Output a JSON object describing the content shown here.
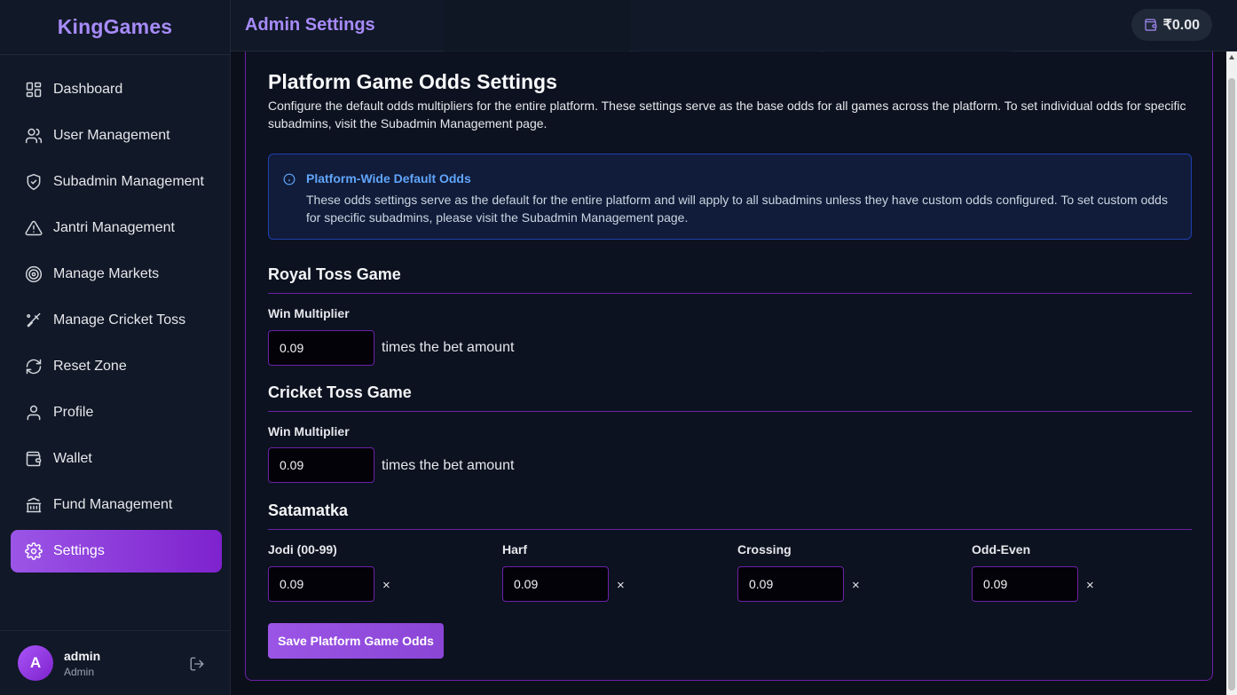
{
  "brand": "KingGames",
  "sidebar": {
    "items": [
      {
        "label": "Dashboard",
        "icon": "dashboard-grid-icon"
      },
      {
        "label": "User Management",
        "icon": "users-icon"
      },
      {
        "label": "Subadmin Management",
        "icon": "shield-icon"
      },
      {
        "label": "Jantri Management",
        "icon": "warning-triangle-icon"
      },
      {
        "label": "Manage Markets",
        "icon": "target-icon"
      },
      {
        "label": "Manage Cricket Toss",
        "icon": "cricket-bat-icon"
      },
      {
        "label": "Reset Zone",
        "icon": "refresh-icon"
      },
      {
        "label": "Profile",
        "icon": "user-icon"
      },
      {
        "label": "Wallet",
        "icon": "wallet-icon"
      },
      {
        "label": "Fund Management",
        "icon": "bank-icon"
      },
      {
        "label": "Settings",
        "icon": "gear-icon",
        "active": true
      }
    ]
  },
  "user": {
    "initial": "A",
    "name": "admin",
    "role": "Admin"
  },
  "header": {
    "title": "Admin Settings",
    "balance": "₹0.00"
  },
  "main": {
    "title": "Platform Game Odds Settings",
    "description": "Configure the default odds multipliers for the entire platform. These settings serve as the base odds for all games across the platform. To set individual odds for specific subadmins, visit the Subadmin Management page.",
    "info": {
      "title": "Platform-Wide Default Odds",
      "text": "These odds settings serve as the default for the entire platform and will apply to all subadmins unless they have custom odds configured. To set custom odds for specific subadmins, please visit the Subadmin Management page."
    },
    "royal_toss": {
      "title": "Royal Toss Game",
      "label": "Win Multiplier",
      "value": "0.09",
      "suffix": "times the bet amount"
    },
    "cricket_toss": {
      "title": "Cricket Toss Game",
      "label": "Win Multiplier",
      "value": "0.09",
      "suffix": "times the bet amount"
    },
    "satamatka": {
      "title": "Satamatka",
      "fields": [
        {
          "label": "Jodi (00-99)",
          "value": "0.09",
          "suffix": "×"
        },
        {
          "label": "Harf",
          "value": "0.09",
          "suffix": "×"
        },
        {
          "label": "Crossing",
          "value": "0.09",
          "suffix": "×"
        },
        {
          "label": "Odd-Even",
          "value": "0.09",
          "suffix": "×"
        }
      ]
    },
    "save_label": "Save Platform Game Odds"
  },
  "colors": {
    "accent": "#a78bfa",
    "active_gradient_start": "#9b55e6",
    "active_gradient_end": "#7e22ce",
    "info_blue": "#60a5fa"
  }
}
